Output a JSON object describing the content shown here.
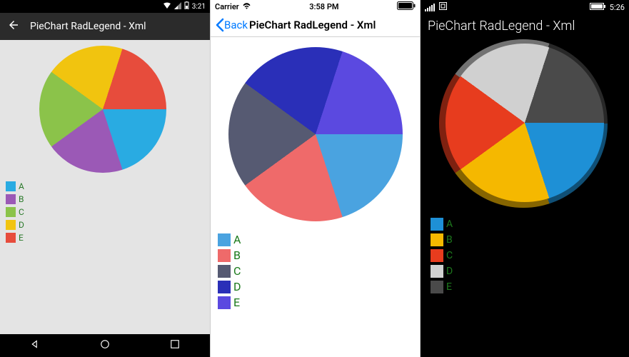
{
  "chart_data": [
    {
      "type": "pie",
      "title": "PieChart RadLegend - Xml",
      "platform": "android",
      "series": [
        {
          "name": "A",
          "value": 60,
          "color": "#29abe2"
        },
        {
          "name": "B",
          "value": 60,
          "color": "#9b59b6"
        },
        {
          "name": "C",
          "value": 60,
          "color": "#8bc34a"
        },
        {
          "name": "D",
          "value": 60,
          "color": "#f1c40f"
        },
        {
          "name": "E",
          "value": 60,
          "color": "#e74c3c"
        }
      ]
    },
    {
      "type": "pie",
      "title": "PieChart RadLegend - Xml",
      "platform": "ios",
      "series": [
        {
          "name": "A",
          "value": 60,
          "color": "#4aa3e0"
        },
        {
          "name": "B",
          "value": 60,
          "color": "#ef6a6a"
        },
        {
          "name": "C",
          "value": 60,
          "color": "#565a72"
        },
        {
          "name": "D",
          "value": 60,
          "color": "#2a2fb8"
        },
        {
          "name": "E",
          "value": 60,
          "color": "#5b49e0"
        }
      ]
    },
    {
      "type": "pie",
      "title": "PieChart RadLegend - Xml",
      "platform": "windows",
      "series": [
        {
          "name": "A",
          "value": 60,
          "color": "#1e90d6"
        },
        {
          "name": "B",
          "value": 60,
          "color": "#f5b800"
        },
        {
          "name": "C",
          "value": 60,
          "color": "#e73c1e"
        },
        {
          "name": "D",
          "value": 60,
          "color": "#d0d0d0"
        },
        {
          "name": "E",
          "value": 60,
          "color": "#4a4a4a"
        }
      ]
    }
  ],
  "android": {
    "status": {
      "time": "3:21"
    },
    "actionbar": {
      "title": "PieChart RadLegend - Xml"
    },
    "legend": [
      "A",
      "B",
      "C",
      "D",
      "E"
    ]
  },
  "ios": {
    "status": {
      "carrier": "Carrier",
      "time": "3:58 PM"
    },
    "nav": {
      "back": "Back",
      "title": "PieChart RadLegend - Xml"
    },
    "legend": [
      "A",
      "B",
      "C",
      "D",
      "E"
    ]
  },
  "win": {
    "status": {
      "time": "5:26"
    },
    "title": "PieChart RadLegend - Xml",
    "legend": [
      "A",
      "B",
      "C",
      "D",
      "E"
    ]
  }
}
